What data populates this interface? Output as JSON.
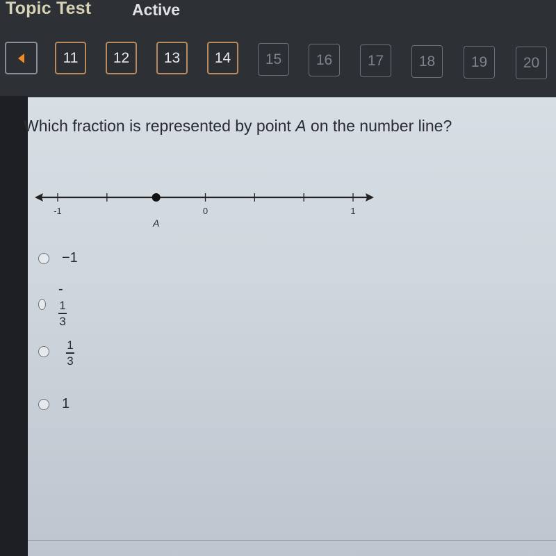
{
  "header": {
    "title": "Topic Test",
    "status": "Active"
  },
  "nav": {
    "back_icon": "left-triangle-icon",
    "accent_color": "#f08c23",
    "questions": [
      {
        "label": "11",
        "state": "visited"
      },
      {
        "label": "12",
        "state": "visited"
      },
      {
        "label": "13",
        "state": "visited"
      },
      {
        "label": "14",
        "state": "current"
      },
      {
        "label": "15",
        "state": "disabled"
      },
      {
        "label": "16",
        "state": "disabled"
      },
      {
        "label": "17",
        "state": "disabled"
      },
      {
        "label": "18",
        "state": "disabled"
      },
      {
        "label": "19",
        "state": "disabled"
      },
      {
        "label": "20",
        "state": "disabled"
      }
    ]
  },
  "question": {
    "text_before": "Which fraction is represented by point ",
    "point_name": "A",
    "text_after": " on the number line?"
  },
  "number_line": {
    "min": -1,
    "max": 1,
    "tick_step": 0.3333,
    "labels": [
      {
        "value": -1,
        "text": "-1"
      },
      {
        "value": 0,
        "text": "0"
      },
      {
        "value": 1,
        "text": "1"
      }
    ],
    "point": {
      "value": -0.3333,
      "label": "A"
    }
  },
  "options": [
    {
      "type": "text",
      "text": "−1"
    },
    {
      "type": "fraction",
      "sign": "-",
      "numerator": "1",
      "denominator": "3"
    },
    {
      "type": "fraction",
      "sign": "",
      "numerator": "1",
      "denominator": "3"
    },
    {
      "type": "text",
      "text": "1"
    }
  ]
}
